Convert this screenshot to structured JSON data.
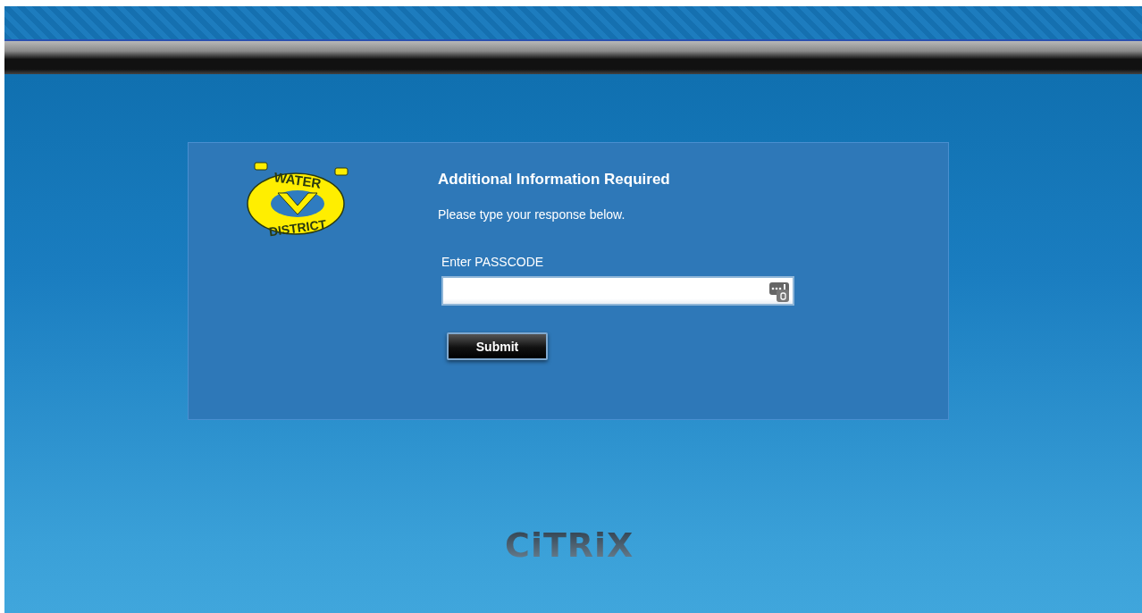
{
  "logo": {
    "top_text": "WATER",
    "bottom_text": "DISTRICT"
  },
  "form": {
    "title": "Additional Information Required",
    "instruction": "Please type your response below.",
    "field_label": "Enter PASSCODE",
    "submit": "Submit"
  },
  "footer_logo": {
    "text": "CiTRiX"
  }
}
